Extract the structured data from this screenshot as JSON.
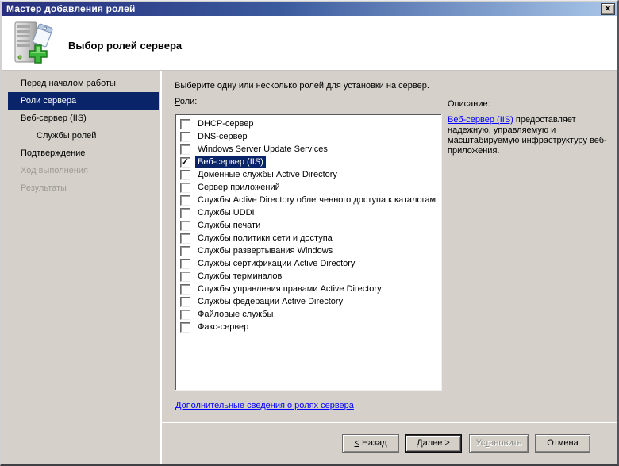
{
  "window": {
    "title": "Мастер добавления ролей"
  },
  "icons": {
    "close": "✕",
    "check": "✓",
    "header_icon_name": "server-add-roles-icon"
  },
  "colors": {
    "titlebar_left": "#272f7d",
    "titlebar_right": "#a9c6e8",
    "selection": "#0a246a",
    "link": "#0000ff",
    "window_bg": "#d5d1ca"
  },
  "header": {
    "title": "Выбор ролей сервера"
  },
  "sidebar": {
    "items": [
      {
        "label": "Перед началом работы",
        "state": "normal"
      },
      {
        "label": "Роли сервера",
        "state": "selected"
      },
      {
        "label": "Веб-сервер (IIS)",
        "state": "normal"
      },
      {
        "label": "Службы ролей",
        "state": "normal",
        "indent": true
      },
      {
        "label": "Подтверждение",
        "state": "normal"
      },
      {
        "label": "Ход выполнения",
        "state": "disabled"
      },
      {
        "label": "Результаты",
        "state": "disabled"
      }
    ]
  },
  "main": {
    "instruction": "Выберите одну или несколько ролей для установки на сервер.",
    "roles_label": {
      "accel": "Р",
      "post": "оли:"
    },
    "roles": [
      {
        "label": "DHCP-сервер",
        "checked": false,
        "selected": false
      },
      {
        "label": "DNS-сервер",
        "checked": false,
        "selected": false
      },
      {
        "label": "Windows Server Update Services",
        "checked": false,
        "selected": false
      },
      {
        "label": "Веб-сервер (IIS)",
        "checked": true,
        "selected": true
      },
      {
        "label": "Доменные службы Active Directory",
        "checked": false,
        "selected": false
      },
      {
        "label": "Сервер приложений",
        "checked": false,
        "selected": false
      },
      {
        "label": "Службы Active Directory облегченного доступа к каталогам",
        "checked": false,
        "selected": false
      },
      {
        "label": "Службы UDDI",
        "checked": false,
        "selected": false
      },
      {
        "label": "Службы печати",
        "checked": false,
        "selected": false
      },
      {
        "label": "Службы политики сети и доступа",
        "checked": false,
        "selected": false
      },
      {
        "label": "Службы развертывания Windows",
        "checked": false,
        "selected": false
      },
      {
        "label": "Службы сертификации Active Directory",
        "checked": false,
        "selected": false
      },
      {
        "label": "Службы терминалов",
        "checked": false,
        "selected": false
      },
      {
        "label": "Службы управления правами Active Directory",
        "checked": false,
        "selected": false
      },
      {
        "label": "Службы федерации Active Directory",
        "checked": false,
        "selected": false
      },
      {
        "label": "Файловые службы",
        "checked": false,
        "selected": false
      },
      {
        "label": "Факс-сервер",
        "checked": false,
        "selected": false
      }
    ],
    "more_info_link": "Дополнительные сведения о ролях сервера"
  },
  "description": {
    "heading": "Описание:",
    "link_text": "Веб-сервер (IIS)",
    "body": "предоставляет надежную, управляемую и масштабируемую инфраструктуру веб-приложения."
  },
  "buttons": {
    "back": {
      "accel": "<",
      "post": " Назад"
    },
    "next": {
      "accel": "Д",
      "post": "алее >"
    },
    "install": {
      "pre": "Ус",
      "accel": "т",
      "post": "ановить"
    },
    "cancel": {
      "label": "Отмена"
    }
  }
}
